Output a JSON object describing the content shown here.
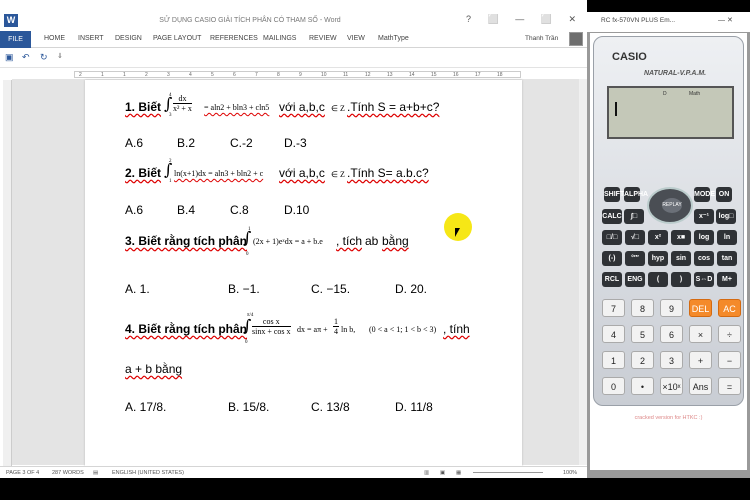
{
  "word": {
    "title": "SỬ DỤNG CASIO GIẢI TÍCH PHÂN CÓ THAM SỐ - Word",
    "file_tab": "FILE",
    "tabs": [
      "HOME",
      "INSERT",
      "DESIGN",
      "PAGE LAYOUT",
      "REFERENCES",
      "MAILINGS",
      "REVIEW",
      "VIEW",
      "MathType"
    ],
    "user": "Thanh Trần",
    "window_controls": "?  ⬜  —  ⬜  ✕",
    "status": {
      "page": "PAGE 3 OF 4",
      "words": "287 WORDS",
      "lang": "ENGLISH (UNITED STATES)",
      "zoom": "100%"
    }
  },
  "ruler_numbers": [
    "2",
    "1",
    "1",
    "2",
    "3",
    "4",
    "5",
    "6",
    "7",
    "8",
    "9",
    "10",
    "11",
    "12",
    "13",
    "14",
    "15",
    "16",
    "17",
    "18"
  ],
  "questions": {
    "q1": {
      "label": "1. Biết",
      "condition": "với a,b,c",
      "set": "∈ Z",
      "ask": ".Tính S = a+b+c?",
      "math_rhs": "= aln2 + bln3 + cln5",
      "int_upper": "4",
      "int_lower": "3",
      "frac_num": "dx",
      "frac_den": "x² + x",
      "answers": [
        "A.6",
        "B.2",
        "C.-2",
        "D.-3"
      ]
    },
    "q2": {
      "label": "2. Biết",
      "condition": "với a,b,c",
      "set": "∈ Z",
      "ask": ".Tính S= a.b.c?",
      "math": "ln(x+1)dx = aln3 + bln2 + c",
      "int_upper": "2",
      "int_lower": "1",
      "answers": [
        "A.6",
        "B.4",
        "C.8",
        "D.10"
      ]
    },
    "q3": {
      "label": "3. Biết rằng tích phân",
      "math": "(2x + 1)eˣdx = a + b.e",
      "int_upper": "1",
      "int_lower": "0",
      "tail1": ", tích",
      "tail2": "ab",
      "tail3": "bằng",
      "answers": [
        "A. 1.",
        "B. −1.",
        "C. −15.",
        "D. 20."
      ]
    },
    "q4": {
      "label": "4. Biết rằng tích phân",
      "int_upper": "π/4",
      "int_lower": "0",
      "frac_num": "cos x",
      "frac_den": "sinx + cos x",
      "math_mid": "dx = aπ +",
      "frac2_num": "1",
      "frac2_den": "4",
      "math_end": "ln b,",
      "cond": "(0 < a < 1; 1 < b < 3)",
      "tail": ", tính",
      "line2": "a + b bằng",
      "answers": [
        "A. 17/8.",
        "B. 15/8.",
        "C. 13/8",
        "D. 11/8"
      ]
    }
  },
  "calculator": {
    "title": "RC fx-570VN PLUS Em...",
    "brand": "CASIO",
    "model": "NATURAL-V.P.A.M.",
    "screen_indicator1": "D",
    "screen_indicator2": "Math",
    "dpad_label": "REPLAY",
    "row_func1": [
      "SHIFT",
      "ALPHA",
      "MODE",
      "ON"
    ],
    "row_func2": [
      "CALC",
      "∫□",
      "x⁻¹",
      "log□"
    ],
    "row_func3": [
      "□/□",
      "√□",
      "x²",
      "x■",
      "log",
      "ln"
    ],
    "row_func4": [
      "(-)",
      "°′″",
      "hyp",
      "sin",
      "cos",
      "tan"
    ],
    "row_func5": [
      "RCL",
      "ENG",
      "(",
      ")",
      "S⇔D",
      "M+"
    ],
    "row_num1": [
      "7",
      "8",
      "9",
      "DEL",
      "AC"
    ],
    "row_num2": [
      "4",
      "5",
      "6",
      "×",
      "÷"
    ],
    "row_num3": [
      "1",
      "2",
      "3",
      "+",
      "−"
    ],
    "row_num4": [
      "0",
      "•",
      "×10ˣ",
      "Ans",
      "="
    ],
    "cracked_text": "cracked version for HTKC :)"
  }
}
